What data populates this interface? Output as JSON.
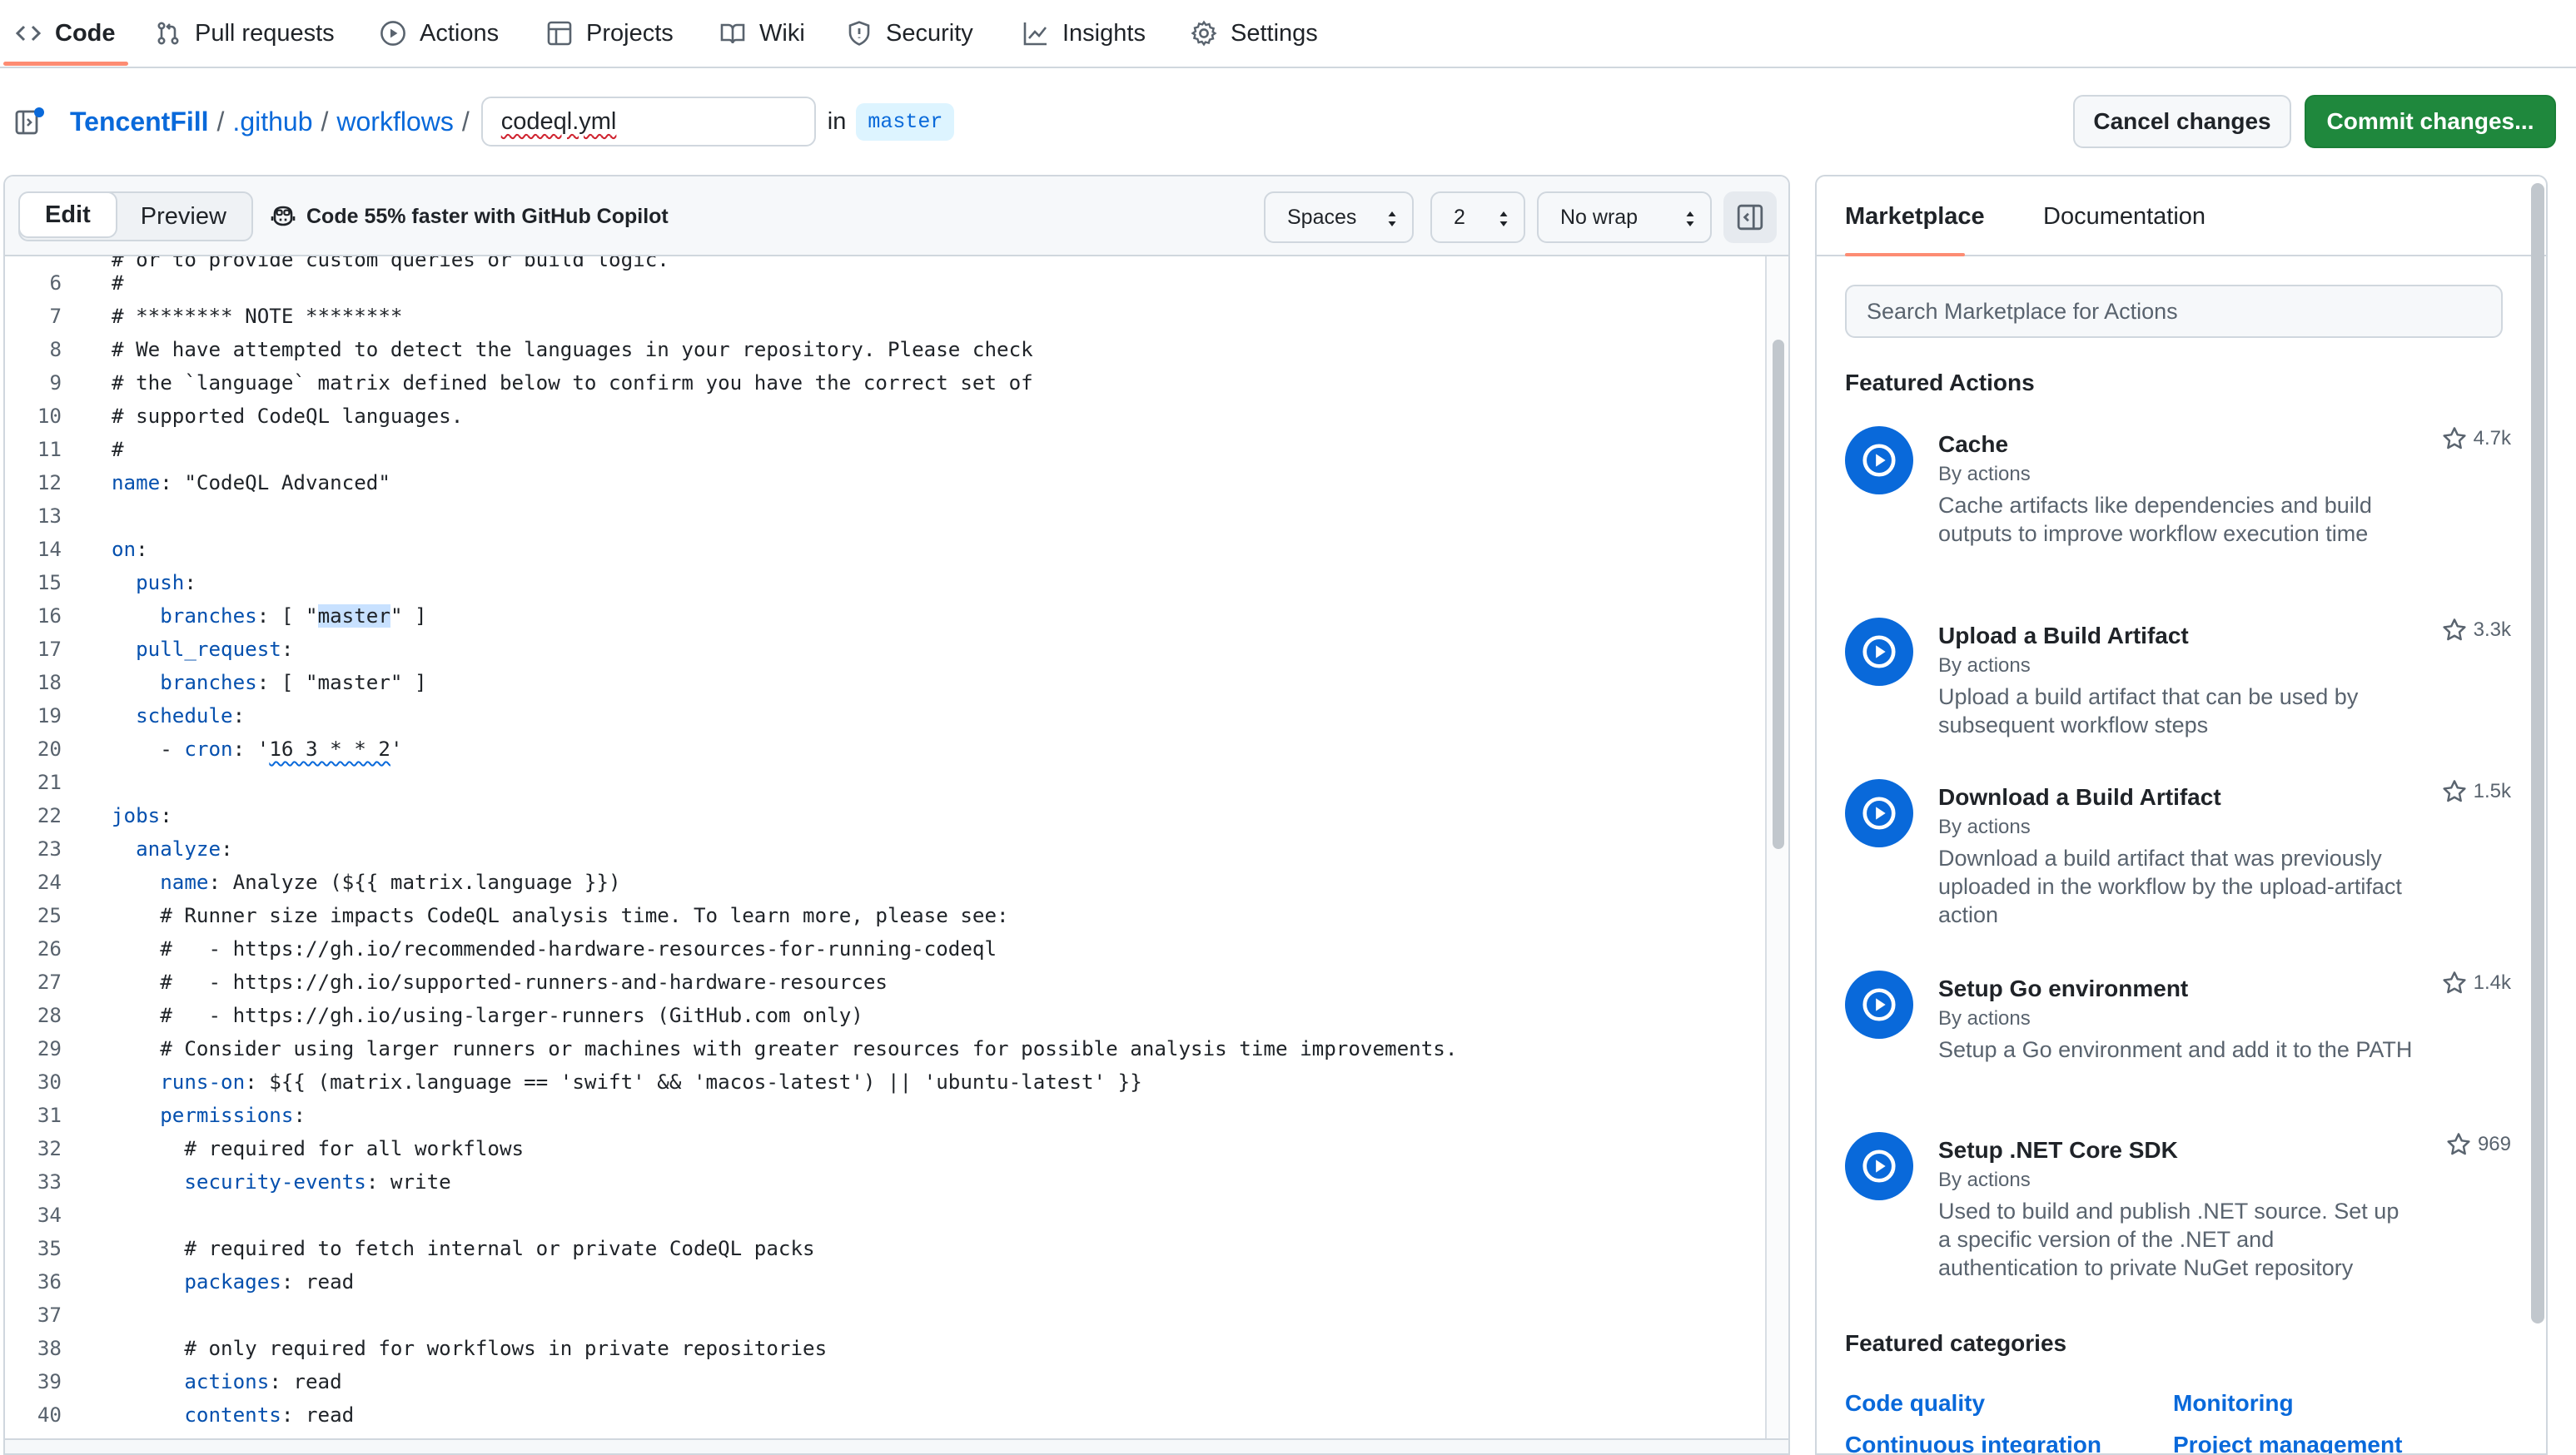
{
  "nav": {
    "items": [
      {
        "label": "Code",
        "icon": "code-icon"
      },
      {
        "label": "Pull requests",
        "icon": "git-pull-request-icon"
      },
      {
        "label": "Actions",
        "icon": "play-circle-icon"
      },
      {
        "label": "Projects",
        "icon": "table-icon"
      },
      {
        "label": "Wiki",
        "icon": "book-icon"
      },
      {
        "label": "Security",
        "icon": "shield-icon"
      },
      {
        "label": "Insights",
        "icon": "graph-icon"
      },
      {
        "label": "Settings",
        "icon": "gear-icon"
      }
    ],
    "active": "Code"
  },
  "breadcrumb": {
    "owner": "TencentFill",
    "repo": ".github",
    "folder": "workflows",
    "separator": "/",
    "filename": "codeql.yml",
    "in_label": "in",
    "branch": "master"
  },
  "header_buttons": {
    "cancel": "Cancel changes",
    "commit": "Commit changes..."
  },
  "editor": {
    "tabs": {
      "edit": "Edit",
      "preview": "Preview"
    },
    "copilot": "Code 55% faster with GitHub Copilot",
    "indent_mode": "Spaces",
    "indent_size": "2",
    "wrap_mode": "No wrap",
    "partial_top_line": "# or to provide custom queries or build logic.",
    "lines": [
      {
        "n": "6",
        "text": "#"
      },
      {
        "n": "7",
        "text": "# ******** NOTE ********"
      },
      {
        "n": "8",
        "text": "# We have attempted to detect the languages in your repository. Please check"
      },
      {
        "n": "9",
        "text": "# the `language` matrix defined below to confirm you have the correct set of"
      },
      {
        "n": "10",
        "text": "# supported CodeQL languages."
      },
      {
        "n": "11",
        "text": "#"
      },
      {
        "n": "12",
        "key": "name",
        "rest": ": \"CodeQL Advanced\""
      },
      {
        "n": "13",
        "text": ""
      },
      {
        "n": "14",
        "key": "on",
        "rest": ":"
      },
      {
        "n": "15",
        "indent": "  ",
        "key": "push",
        "rest": ":"
      },
      {
        "n": "16",
        "indent": "    ",
        "key": "branches",
        "rest": ": [ \"",
        "hl": "master",
        "after": "\" ]"
      },
      {
        "n": "17",
        "indent": "  ",
        "key": "pull_request",
        "rest": ":"
      },
      {
        "n": "18",
        "indent": "    ",
        "key": "branches",
        "rest": ": [ \"master\" ]"
      },
      {
        "n": "19",
        "indent": "  ",
        "key": "schedule",
        "rest": ":"
      },
      {
        "n": "20",
        "indent": "    - ",
        "key": "cron",
        "rest": ": '",
        "wavy": "16 3 * * 2",
        "after": "'"
      },
      {
        "n": "21",
        "text": ""
      },
      {
        "n": "22",
        "key": "jobs",
        "rest": ":"
      },
      {
        "n": "23",
        "indent": "  ",
        "key": "analyze",
        "rest": ":"
      },
      {
        "n": "24",
        "indent": "    ",
        "key": "name",
        "rest": ": Analyze (${{ matrix.language }})"
      },
      {
        "n": "25",
        "text": "    # Runner size impacts CodeQL analysis time. To learn more, please see:"
      },
      {
        "n": "26",
        "text": "    #   - https://gh.io/recommended-hardware-resources-for-running-codeql"
      },
      {
        "n": "27",
        "text": "    #   - https://gh.io/supported-runners-and-hardware-resources"
      },
      {
        "n": "28",
        "text": "    #   - https://gh.io/using-larger-runners (GitHub.com only)"
      },
      {
        "n": "29",
        "text": "    # Consider using larger runners or machines with greater resources for possible analysis time improvements."
      },
      {
        "n": "30",
        "indent": "    ",
        "key": "runs-on",
        "rest": ": ${{ (matrix.language == 'swift' && 'macos-latest') || 'ubuntu-latest' }}"
      },
      {
        "n": "31",
        "indent": "    ",
        "key": "permissions",
        "rest": ":"
      },
      {
        "n": "32",
        "text": "      # required for all workflows"
      },
      {
        "n": "33",
        "indent": "      ",
        "key": "security-events",
        "rest": ": write"
      },
      {
        "n": "34",
        "text": ""
      },
      {
        "n": "35",
        "text": "      # required to fetch internal or private CodeQL packs"
      },
      {
        "n": "36",
        "indent": "      ",
        "key": "packages",
        "rest": ": read"
      },
      {
        "n": "37",
        "text": ""
      },
      {
        "n": "38",
        "text": "      # only required for workflows in private repositories"
      },
      {
        "n": "39",
        "indent": "      ",
        "key": "actions",
        "rest": ": read"
      },
      {
        "n": "40",
        "indent": "      ",
        "key": "contents",
        "rest": ": read"
      }
    ]
  },
  "side_panel": {
    "tabs": {
      "marketplace": "Marketplace",
      "documentation": "Documentation"
    },
    "search_placeholder": "Search Marketplace for Actions",
    "featured_heading": "Featured Actions",
    "actions": [
      {
        "title": "Cache",
        "by": "By actions",
        "desc": "Cache artifacts like dependencies and build outputs to improve workflow execution time",
        "stars": "4.7k"
      },
      {
        "title": "Upload a Build Artifact",
        "by": "By actions",
        "desc": "Upload a build artifact that can be used by subsequent workflow steps",
        "stars": "3.3k"
      },
      {
        "title": "Download a Build Artifact",
        "by": "By actions",
        "desc": "Download a build artifact that was previously uploaded in the workflow by the upload-artifact action",
        "stars": "1.5k"
      },
      {
        "title": "Setup Go environment",
        "by": "By actions",
        "desc": "Setup a Go environment and add it to the PATH",
        "stars": "1.4k"
      },
      {
        "title": "Setup .NET Core SDK",
        "by": "By actions",
        "desc": "Used to build and publish .NET source. Set up a specific version of the .NET and authentication to private NuGet repository",
        "stars": "969"
      }
    ],
    "categories_heading": "Featured categories",
    "categories": [
      "Code quality",
      "Monitoring",
      "Continuous integration",
      "Project management"
    ]
  },
  "colors": {
    "accent": "#0969da",
    "commit_green": "#1f883d",
    "underline_orange": "#fd8c73",
    "yaml_key": "#0550ae"
  }
}
